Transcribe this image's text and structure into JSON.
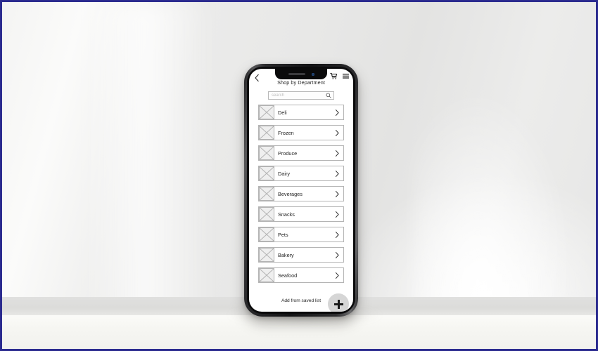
{
  "scene": {
    "description": "Smartphone mockup on a white table showing a grocery app wireframe",
    "border_color": "#2b2b8f",
    "wall_color": "#e8e8e7",
    "table_color": "#f8f8f5"
  },
  "app": {
    "header": {
      "back_icon": "chevron-left-icon",
      "title": "Shop by Department",
      "cart_icon": "shopping-cart-icon",
      "menu_icon": "hamburger-menu-icon"
    },
    "search": {
      "placeholder": "search",
      "value": "",
      "icon": "magnifier-icon"
    },
    "departments": [
      {
        "label": "Deli",
        "thumb": "image-placeholder-icon",
        "chevron": "chevron-right-icon"
      },
      {
        "label": "Frozen",
        "thumb": "image-placeholder-icon",
        "chevron": "chevron-right-icon"
      },
      {
        "label": "Produce",
        "thumb": "image-placeholder-icon",
        "chevron": "chevron-right-icon"
      },
      {
        "label": "Dairy",
        "thumb": "image-placeholder-icon",
        "chevron": "chevron-right-icon"
      },
      {
        "label": "Beverages",
        "thumb": "image-placeholder-icon",
        "chevron": "chevron-right-icon"
      },
      {
        "label": "Snacks",
        "thumb": "image-placeholder-icon",
        "chevron": "chevron-right-icon"
      },
      {
        "label": "Pets",
        "thumb": "image-placeholder-icon",
        "chevron": "chevron-right-icon"
      },
      {
        "label": "Bakery",
        "thumb": "image-placeholder-icon",
        "chevron": "chevron-right-icon"
      },
      {
        "label": "Seafood",
        "thumb": "image-placeholder-icon",
        "chevron": "chevron-right-icon"
      }
    ],
    "footer": {
      "saved_list_label": "Add from saved list",
      "fab_icon": "plus-icon"
    }
  }
}
